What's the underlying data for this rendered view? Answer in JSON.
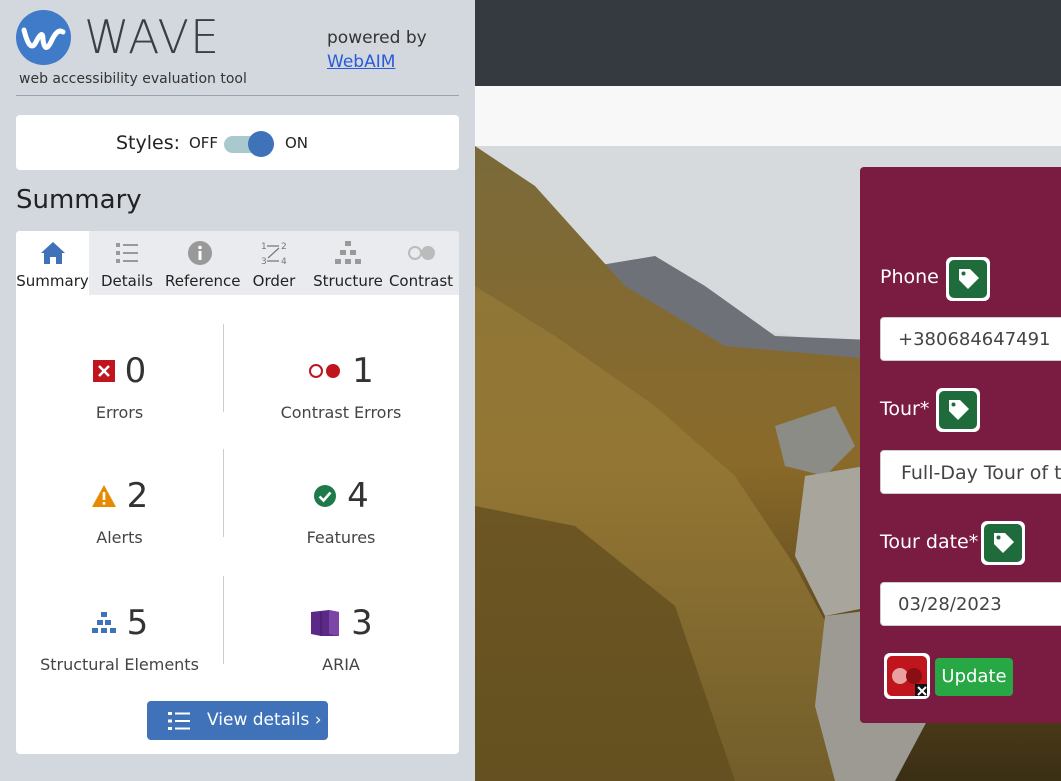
{
  "brand": {
    "name": "WAVE",
    "tagline": "web accessibility evaluation tool",
    "powered_by": "powered by",
    "powered_link": "WebAIM"
  },
  "styles_toggle": {
    "label": "Styles:",
    "off": "OFF",
    "on": "ON",
    "state": "on"
  },
  "summary_heading": "Summary",
  "tabs": [
    {
      "label": "Summary",
      "icon": "home-icon",
      "active": true
    },
    {
      "label": "Details",
      "icon": "list-icon",
      "active": false
    },
    {
      "label": "Reference",
      "icon": "info-icon",
      "active": false
    },
    {
      "label": "Order",
      "icon": "order-icon",
      "active": false
    },
    {
      "label": "Structure",
      "icon": "structure-icon",
      "active": false
    },
    {
      "label": "Contrast",
      "icon": "contrast-icon",
      "active": false
    }
  ],
  "stats": {
    "errors": {
      "count": "0",
      "label": "Errors"
    },
    "contrast_errors": {
      "count": "1",
      "label": "Contrast Errors"
    },
    "alerts": {
      "count": "2",
      "label": "Alerts"
    },
    "features": {
      "count": "4",
      "label": "Features"
    },
    "structural": {
      "count": "5",
      "label": "Structural Elements"
    },
    "aria": {
      "count": "3",
      "label": "ARIA"
    }
  },
  "view_details": "View details ›",
  "form": {
    "phone_label": "Phone",
    "phone_value": "+380684647491",
    "tour_label": "Tour*",
    "tour_value": "Full-Day Tour of th",
    "date_label": "Tour date*",
    "date_value": "03/28/2023",
    "update_button": "Update"
  },
  "colors": {
    "wave_blue": "#3f72b8",
    "form_panel": "#7a1c42",
    "update_green": "#28a745",
    "error_red": "#c0151d"
  }
}
